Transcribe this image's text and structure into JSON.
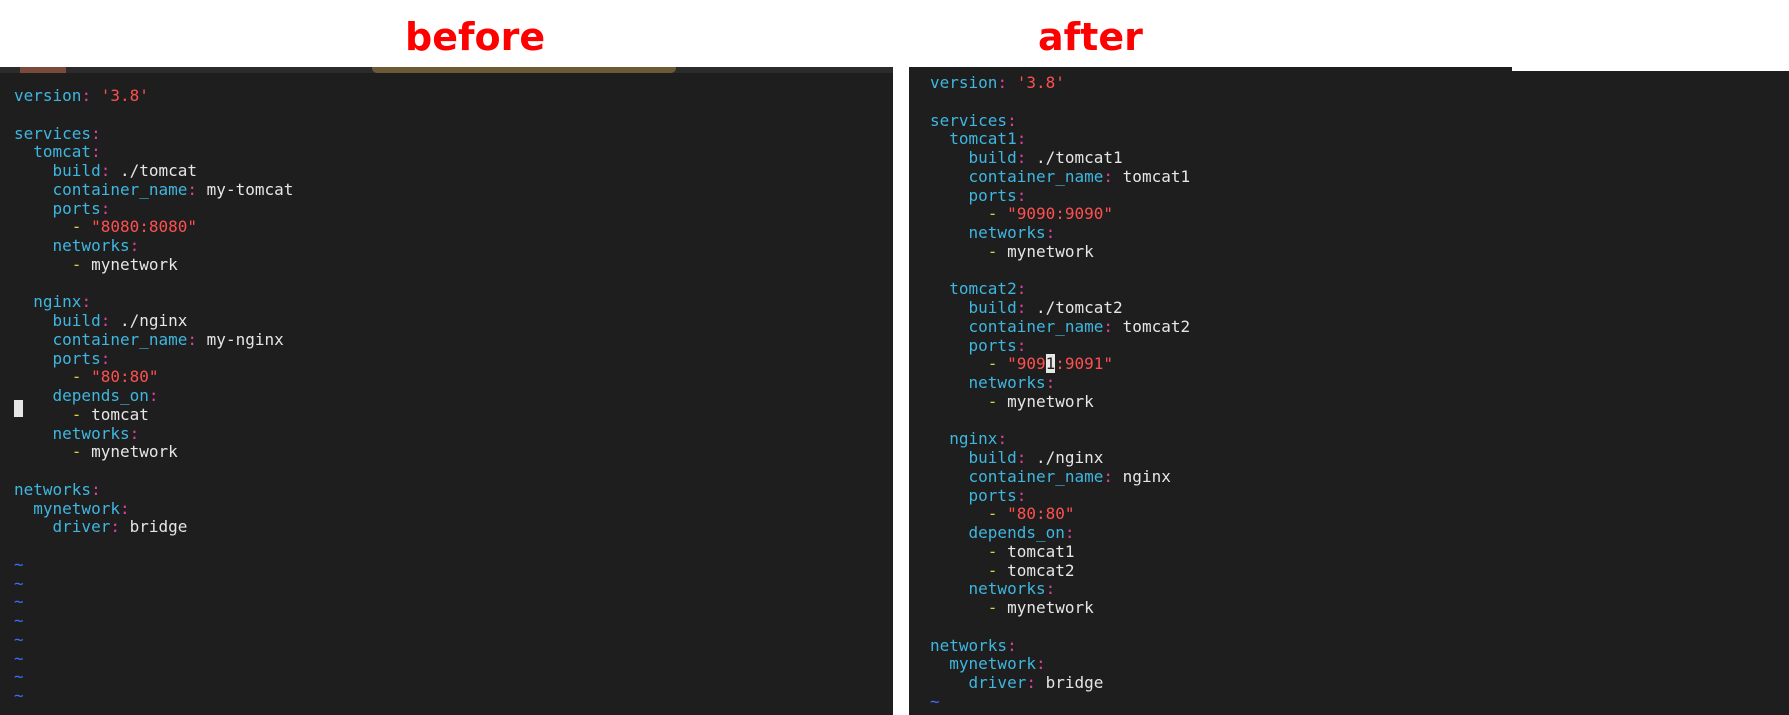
{
  "captions": {
    "before": "before",
    "after": "after"
  },
  "before": {
    "version_key": "version",
    "version_value": "'3.8'",
    "services_key": "services",
    "tomcat": {
      "name": "tomcat",
      "build_key": "build",
      "build_value": "./tomcat",
      "container_key": "container_name",
      "container_value": "my-tomcat",
      "ports_key": "ports",
      "port": "\"8080:8080\"",
      "networks_key": "networks",
      "network": "mynetwork"
    },
    "nginx": {
      "name": "nginx",
      "build_key": "build",
      "build_value": "./nginx",
      "container_key": "container_name",
      "container_value": "my-nginx",
      "ports_key": "ports",
      "port": "\"80:80\"",
      "depends_key": "depends_on",
      "depends": [
        "tomcat"
      ],
      "networks_key": "networks",
      "network": "mynetwork"
    },
    "networks_key": "networks",
    "mynetwork_key": "mynetwork",
    "driver_key": "driver",
    "driver_value": "bridge",
    "tilde": "~"
  },
  "after": {
    "version_key": "version",
    "version_value": "'3.8'",
    "services_key": "services",
    "tomcat1": {
      "name": "tomcat1",
      "build_key": "build",
      "build_value": "./tomcat1",
      "container_key": "container_name",
      "container_value": "tomcat1",
      "ports_key": "ports",
      "port": "\"9090:9090\"",
      "networks_key": "networks",
      "network": "mynetwork"
    },
    "tomcat2": {
      "name": "tomcat2",
      "build_key": "build",
      "build_value": "./tomcat2",
      "container_key": "container_name",
      "container_value": "tomcat2",
      "ports_key": "ports",
      "port_before_cursor": "\"909",
      "port_cursor_char": "1",
      "port_after_cursor": ":9091\"",
      "networks_key": "networks",
      "network": "mynetwork"
    },
    "nginx": {
      "name": "nginx",
      "build_key": "build",
      "build_value": "./nginx",
      "container_key": "container_name",
      "container_value": "nginx",
      "ports_key": "ports",
      "port": "\"80:80\"",
      "depends_key": "depends_on",
      "depends": [
        "tomcat1",
        "tomcat2"
      ],
      "networks_key": "networks",
      "network": "mynetwork"
    },
    "networks_key": "networks",
    "mynetwork_key": "mynetwork",
    "driver_key": "driver",
    "driver_value": "bridge",
    "tilde": "~"
  },
  "colors": {
    "background": "#1e1e1e",
    "key": "#3fb6e0",
    "punctuation": "#e040a0",
    "string": "#ff5050",
    "dash": "#e0d040",
    "value": "#e6e6e6",
    "tilde": "#3a70ff",
    "caption": "#ff0000"
  }
}
